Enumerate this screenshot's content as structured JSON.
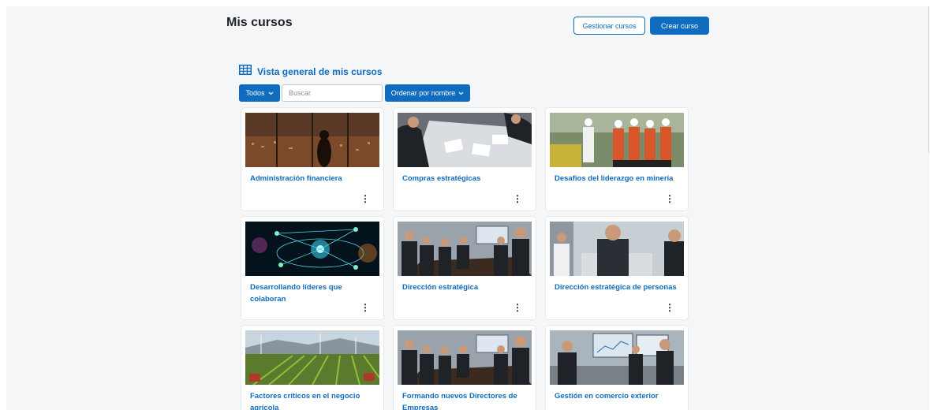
{
  "header": {
    "title": "Mis cursos",
    "manage_label": "Gestionar cursos",
    "create_label": "Crear curso"
  },
  "overview": {
    "title": "Vista general de mis cursos",
    "icon": "grid-icon",
    "filter_label": "Todos",
    "search_placeholder": "Buscar",
    "search_value": "",
    "sort_label": "Ordenar por nombre"
  },
  "colors": {
    "primary": "#0f6cbf",
    "background": "#f5f6f8"
  },
  "courses": [
    {
      "title": "Administración financiera",
      "image": "city-night-office"
    },
    {
      "title": "Compras estratégicas",
      "image": "business-meeting-documents"
    },
    {
      "title": "Desafíos del liderazgo en minería",
      "image": "mining-workers-helmets"
    },
    {
      "title": "Desarrollando líderes que colaboran",
      "image": "network-digital-people"
    },
    {
      "title": "Dirección estratégica",
      "image": "boardroom-meeting"
    },
    {
      "title": "Dirección estratégica de personas",
      "image": "office-executives"
    },
    {
      "title": "Factores críticos en el negocio agrícola",
      "image": "agricultural-field"
    },
    {
      "title": "Formando nuevos Directores de Empresas",
      "image": "boardroom-meeting"
    },
    {
      "title": "Gestión en comercio exterior",
      "image": "trade-meeting-screens"
    }
  ]
}
